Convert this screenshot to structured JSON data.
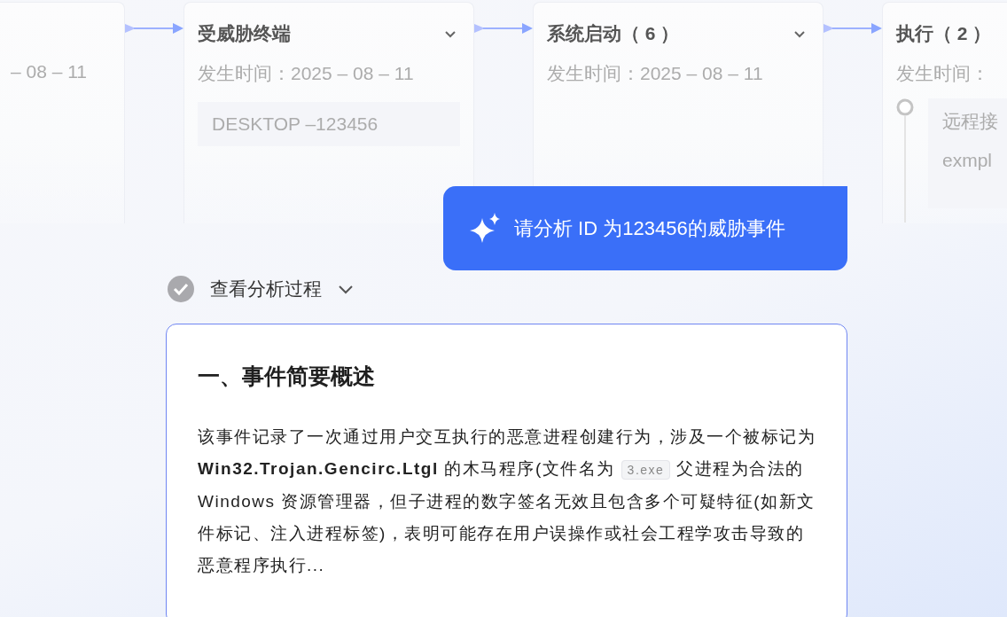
{
  "timeline": {
    "cards": [
      {
        "kind": "partial",
        "date": "– 08 – 11"
      },
      {
        "kind": "device",
        "title": "受威胁终端",
        "date": "发生时间：2025 – 08 – 11",
        "device": "DESKTOP –123456"
      },
      {
        "kind": "stage",
        "title": "系统启动（ 6 ）",
        "date": "发生时间：2025 – 08 – 11"
      },
      {
        "kind": "events",
        "title": "执行（ 2 ）",
        "date": "发生时间：",
        "events": [
          {
            "title": "远程接",
            "detail": "exmpl"
          }
        ]
      }
    ]
  },
  "user_message": "请分析 ID 为123456的威胁事件",
  "analysis_toggle": {
    "label": "查看分析过程",
    "done": true
  },
  "answer": {
    "heading": "一、事件简要概述",
    "paragraph": {
      "before": "该事件记录了一次通过用户交互执行的恶意进程创建行为，涉及一个被标记为 **Win32.Trojan.Gencirc.Ltgl** 的木马程序(文件名为",
      "file": "3.exe",
      "after": "父进程为合法的 Windows 资源管理器，但子进程的数字签名无效且包含多个可疑特征(如新文件标记、注入进程标签)，表明可能存在用户误操作或社会工程学攻击导致的恶意程序执行..."
    }
  }
}
